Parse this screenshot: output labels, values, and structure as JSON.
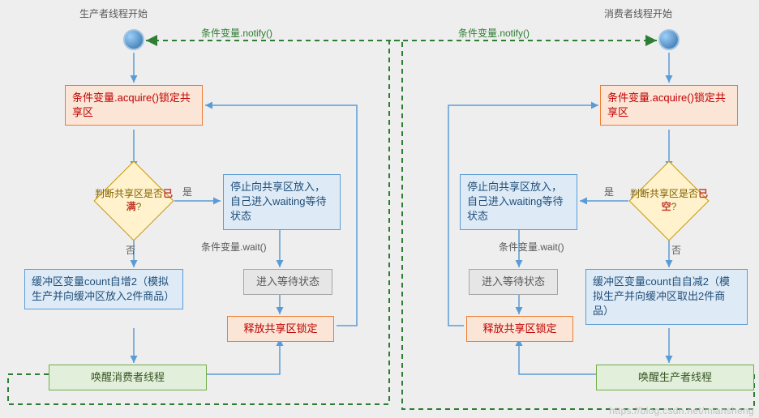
{
  "titles": {
    "producer_start": "生产者线程开始",
    "consumer_start": "消费者线程开始"
  },
  "labels": {
    "notify_left": "条件变量.notify()",
    "notify_right": "条件变量.notify()",
    "yes": "是",
    "no": "否",
    "wait_left": "条件变量.wait()",
    "wait_right": "条件变量.wait()"
  },
  "producer": {
    "acquire": "条件变量.acquire()锁定共享区",
    "decision_pre": "判断共享区是否",
    "decision_key": "已满",
    "decision_post": "?",
    "stop_wait": "停止向共享区放入，自己进入waiting等待状态",
    "enter_wait": "进入等待状态",
    "release": "释放共享区锁定",
    "count": "缓冲区变量count自增2（模拟生产并向缓冲区放入2件商品）",
    "wake": "唤醒消费者线程"
  },
  "consumer": {
    "acquire": "条件变量.acquire()锁定共享区",
    "decision_pre": "判断共享区是否",
    "decision_key": "已空",
    "decision_post": "?",
    "stop_wait": "停止向共享区放入，自己进入waiting等待状态",
    "enter_wait": "进入等待状态",
    "release": "释放共享区锁定",
    "count": "缓冲区变量count自自减2（模拟生产并向缓冲区取出2件商品）",
    "wake": "唤醒生产者线程"
  },
  "watermark": "https://blog.csdn.net/miansheng"
}
